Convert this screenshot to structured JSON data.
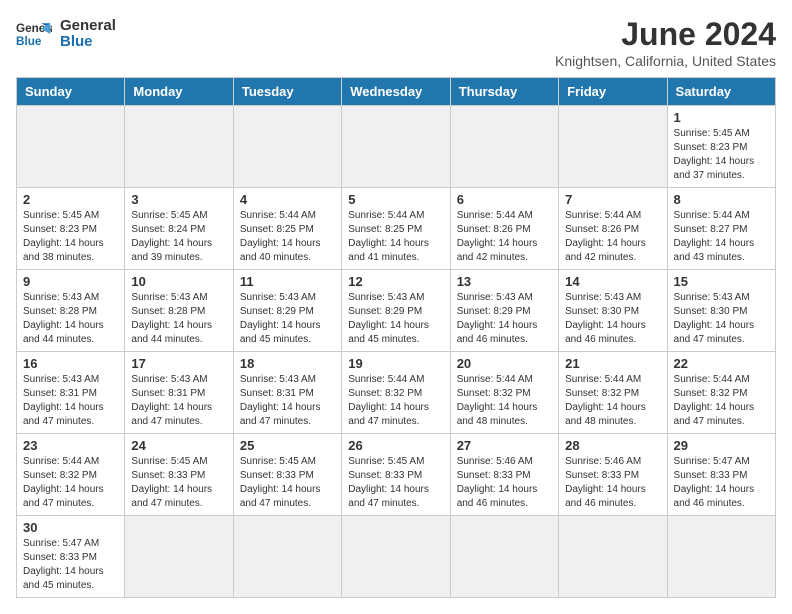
{
  "header": {
    "logo_general": "General",
    "logo_blue": "Blue",
    "title": "June 2024",
    "subtitle": "Knightsen, California, United States"
  },
  "weekdays": [
    "Sunday",
    "Monday",
    "Tuesday",
    "Wednesday",
    "Thursday",
    "Friday",
    "Saturday"
  ],
  "weeks": [
    [
      {
        "day": "",
        "info": ""
      },
      {
        "day": "",
        "info": ""
      },
      {
        "day": "",
        "info": ""
      },
      {
        "day": "",
        "info": ""
      },
      {
        "day": "",
        "info": ""
      },
      {
        "day": "",
        "info": ""
      },
      {
        "day": "1",
        "info": "Sunrise: 5:45 AM\nSunset: 8:23 PM\nDaylight: 14 hours\nand 37 minutes."
      }
    ],
    [
      {
        "day": "2",
        "info": "Sunrise: 5:45 AM\nSunset: 8:23 PM\nDaylight: 14 hours\nand 38 minutes."
      },
      {
        "day": "3",
        "info": "Sunrise: 5:45 AM\nSunset: 8:24 PM\nDaylight: 14 hours\nand 39 minutes."
      },
      {
        "day": "4",
        "info": "Sunrise: 5:44 AM\nSunset: 8:25 PM\nDaylight: 14 hours\nand 40 minutes."
      },
      {
        "day": "5",
        "info": "Sunrise: 5:44 AM\nSunset: 8:25 PM\nDaylight: 14 hours\nand 41 minutes."
      },
      {
        "day": "6",
        "info": "Sunrise: 5:44 AM\nSunset: 8:26 PM\nDaylight: 14 hours\nand 42 minutes."
      },
      {
        "day": "7",
        "info": "Sunrise: 5:44 AM\nSunset: 8:26 PM\nDaylight: 14 hours\nand 42 minutes."
      },
      {
        "day": "8",
        "info": "Sunrise: 5:44 AM\nSunset: 8:27 PM\nDaylight: 14 hours\nand 43 minutes."
      }
    ],
    [
      {
        "day": "9",
        "info": "Sunrise: 5:43 AM\nSunset: 8:28 PM\nDaylight: 14 hours\nand 44 minutes."
      },
      {
        "day": "10",
        "info": "Sunrise: 5:43 AM\nSunset: 8:28 PM\nDaylight: 14 hours\nand 44 minutes."
      },
      {
        "day": "11",
        "info": "Sunrise: 5:43 AM\nSunset: 8:29 PM\nDaylight: 14 hours\nand 45 minutes."
      },
      {
        "day": "12",
        "info": "Sunrise: 5:43 AM\nSunset: 8:29 PM\nDaylight: 14 hours\nand 45 minutes."
      },
      {
        "day": "13",
        "info": "Sunrise: 5:43 AM\nSunset: 8:29 PM\nDaylight: 14 hours\nand 46 minutes."
      },
      {
        "day": "14",
        "info": "Sunrise: 5:43 AM\nSunset: 8:30 PM\nDaylight: 14 hours\nand 46 minutes."
      },
      {
        "day": "15",
        "info": "Sunrise: 5:43 AM\nSunset: 8:30 PM\nDaylight: 14 hours\nand 47 minutes."
      }
    ],
    [
      {
        "day": "16",
        "info": "Sunrise: 5:43 AM\nSunset: 8:31 PM\nDaylight: 14 hours\nand 47 minutes."
      },
      {
        "day": "17",
        "info": "Sunrise: 5:43 AM\nSunset: 8:31 PM\nDaylight: 14 hours\nand 47 minutes."
      },
      {
        "day": "18",
        "info": "Sunrise: 5:43 AM\nSunset: 8:31 PM\nDaylight: 14 hours\nand 47 minutes."
      },
      {
        "day": "19",
        "info": "Sunrise: 5:44 AM\nSunset: 8:32 PM\nDaylight: 14 hours\nand 47 minutes."
      },
      {
        "day": "20",
        "info": "Sunrise: 5:44 AM\nSunset: 8:32 PM\nDaylight: 14 hours\nand 48 minutes."
      },
      {
        "day": "21",
        "info": "Sunrise: 5:44 AM\nSunset: 8:32 PM\nDaylight: 14 hours\nand 48 minutes."
      },
      {
        "day": "22",
        "info": "Sunrise: 5:44 AM\nSunset: 8:32 PM\nDaylight: 14 hours\nand 47 minutes."
      }
    ],
    [
      {
        "day": "23",
        "info": "Sunrise: 5:44 AM\nSunset: 8:32 PM\nDaylight: 14 hours\nand 47 minutes."
      },
      {
        "day": "24",
        "info": "Sunrise: 5:45 AM\nSunset: 8:33 PM\nDaylight: 14 hours\nand 47 minutes."
      },
      {
        "day": "25",
        "info": "Sunrise: 5:45 AM\nSunset: 8:33 PM\nDaylight: 14 hours\nand 47 minutes."
      },
      {
        "day": "26",
        "info": "Sunrise: 5:45 AM\nSunset: 8:33 PM\nDaylight: 14 hours\nand 47 minutes."
      },
      {
        "day": "27",
        "info": "Sunrise: 5:46 AM\nSunset: 8:33 PM\nDaylight: 14 hours\nand 46 minutes."
      },
      {
        "day": "28",
        "info": "Sunrise: 5:46 AM\nSunset: 8:33 PM\nDaylight: 14 hours\nand 46 minutes."
      },
      {
        "day": "29",
        "info": "Sunrise: 5:47 AM\nSunset: 8:33 PM\nDaylight: 14 hours\nand 46 minutes."
      }
    ],
    [
      {
        "day": "30",
        "info": "Sunrise: 5:47 AM\nSunset: 8:33 PM\nDaylight: 14 hours\nand 45 minutes."
      },
      {
        "day": "",
        "info": ""
      },
      {
        "day": "",
        "info": ""
      },
      {
        "day": "",
        "info": ""
      },
      {
        "day": "",
        "info": ""
      },
      {
        "day": "",
        "info": ""
      },
      {
        "day": "",
        "info": ""
      }
    ]
  ]
}
